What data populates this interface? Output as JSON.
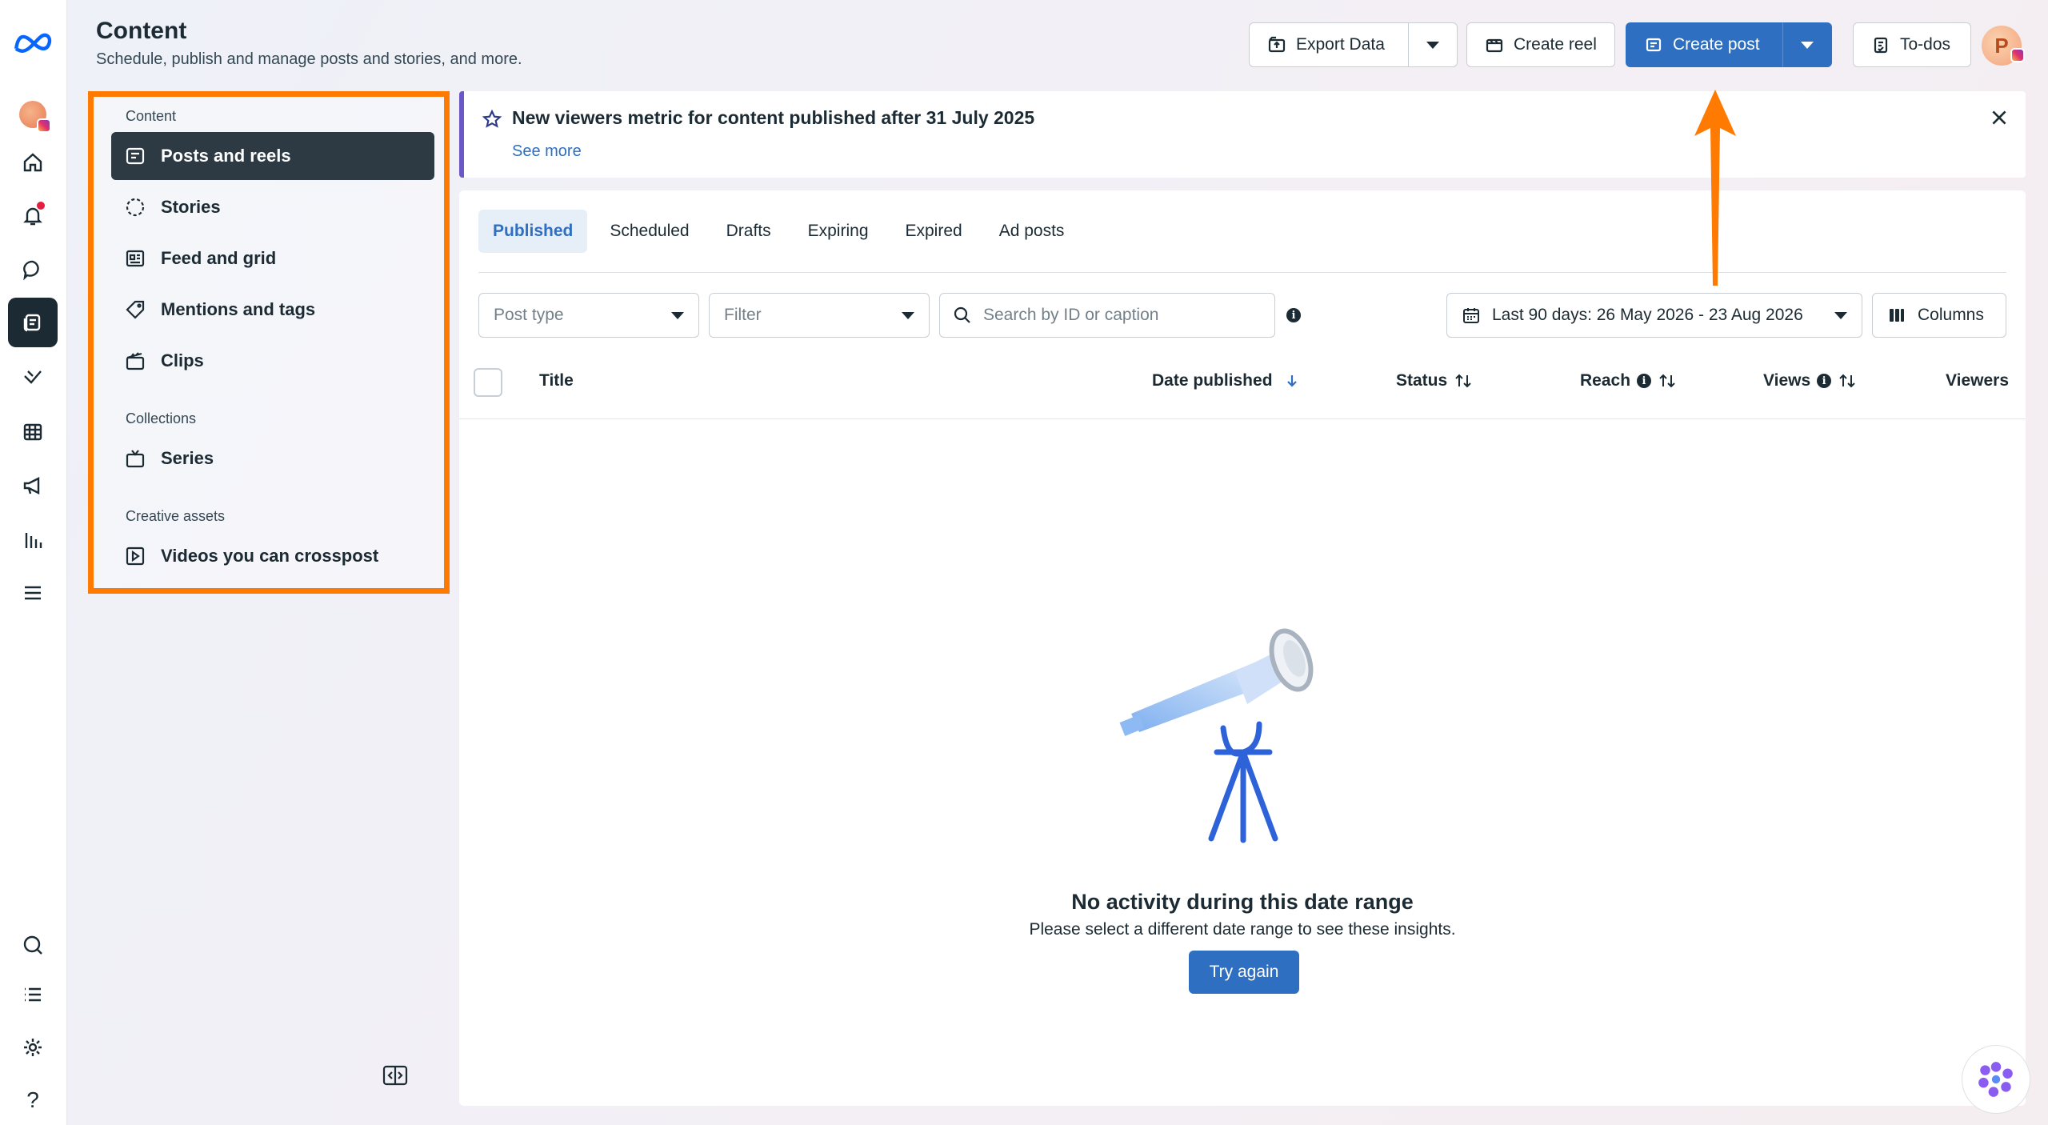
{
  "header": {
    "title": "Content",
    "subtitle": "Schedule, publish and manage posts and stories, and more.",
    "export_label": "Export Data",
    "create_reel_label": "Create reel",
    "create_post_label": "Create post",
    "todos_label": "To-dos",
    "avatar_initial": "P"
  },
  "sidenav": {
    "section_content": "Content",
    "section_collections": "Collections",
    "section_creative": "Creative assets",
    "items": [
      {
        "label": "Posts and reels"
      },
      {
        "label": "Stories"
      },
      {
        "label": "Feed and grid"
      },
      {
        "label": "Mentions and tags"
      },
      {
        "label": "Clips"
      },
      {
        "label": "Series"
      },
      {
        "label": "Videos you can crosspost"
      }
    ]
  },
  "banner": {
    "title": "New viewers metric for content published after 31 July 2025",
    "link": "See more"
  },
  "tabs": [
    "Published",
    "Scheduled",
    "Drafts",
    "Expiring",
    "Expired",
    "Ad posts"
  ],
  "filters": {
    "post_type": "Post type",
    "filter": "Filter",
    "search_placeholder": "Search by ID or caption",
    "date_range": "Last 90 days: 26 May 2026 - 23 Aug 2026",
    "columns": "Columns"
  },
  "table": {
    "headers": [
      "Title",
      "Date published",
      "Status",
      "Reach",
      "Views",
      "Viewers"
    ]
  },
  "empty_state": {
    "title": "No activity during this date range",
    "subtitle": "Please select a different date range to see these insights.",
    "button": "Try again"
  },
  "colors": {
    "accent": "#2f6fc1",
    "highlight": "#ff7a00",
    "banner_stripe": "#6c57c6"
  }
}
